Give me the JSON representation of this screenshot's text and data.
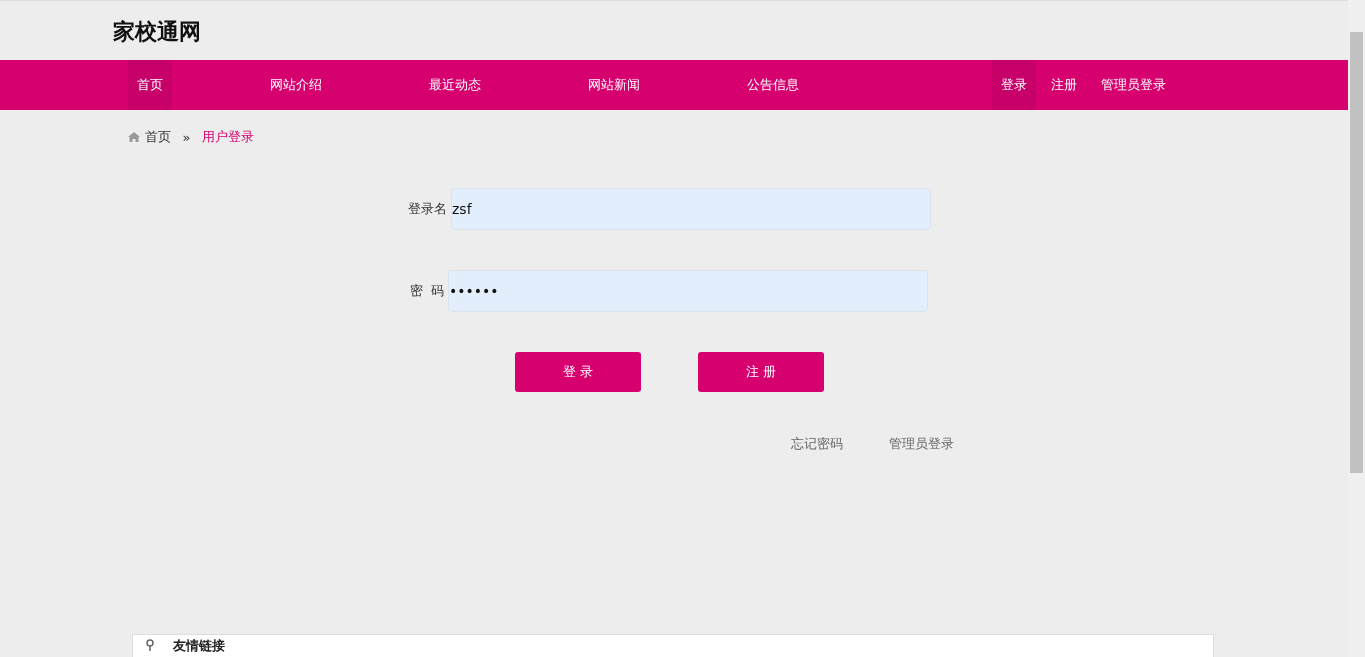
{
  "site_title": "家校通网",
  "nav": {
    "left": [
      {
        "label": "首页",
        "selected": true
      },
      {
        "label": "网站介绍",
        "selected": false
      },
      {
        "label": "最近动态",
        "selected": false
      },
      {
        "label": "网站新闻",
        "selected": false
      },
      {
        "label": "公告信息",
        "selected": false
      }
    ],
    "right": [
      {
        "label": "登录",
        "selected": true
      },
      {
        "label": "注册",
        "selected": false
      },
      {
        "label": "管理员登录",
        "selected": false
      }
    ]
  },
  "breadcrumb": {
    "home": "首页",
    "separator": "»",
    "current": "用户登录"
  },
  "form": {
    "fields": [
      {
        "label": "登录名",
        "value": "zsf"
      },
      {
        "label": "密  码",
        "value": "••••••"
      }
    ],
    "buttons": [
      "登 录",
      "注 册"
    ],
    "links": [
      "忘记密码",
      "管理员登录"
    ]
  },
  "links_panel": {
    "title": "友情链接"
  }
}
